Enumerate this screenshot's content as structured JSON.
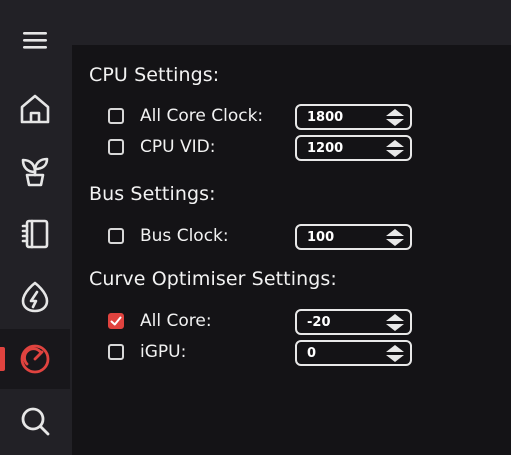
{
  "sidebar": {
    "items": [
      {
        "icon": "menu-icon"
      },
      {
        "icon": "home-icon"
      },
      {
        "icon": "plant-icon"
      },
      {
        "icon": "notebook-icon"
      },
      {
        "icon": "power-icon"
      },
      {
        "icon": "gauge-icon",
        "active": true
      },
      {
        "icon": "search-icon"
      }
    ],
    "accent": "#e0433f"
  },
  "sections": {
    "cpu": {
      "title": "CPU Settings:",
      "all_core_clock": {
        "label": "All Core Clock:",
        "checked": false,
        "value": "1800"
      },
      "cpu_vid": {
        "label": "CPU VID:",
        "checked": false,
        "value": "1200"
      }
    },
    "bus": {
      "title": "Bus Settings:",
      "bus_clock": {
        "label": "Bus Clock:",
        "checked": false,
        "value": "100"
      }
    },
    "curve": {
      "title": "Curve Optimiser Settings:",
      "all_core": {
        "label": "All Core:",
        "checked": true,
        "value": "-20"
      },
      "igpu": {
        "label": "iGPU:",
        "checked": false,
        "value": "0"
      }
    }
  }
}
